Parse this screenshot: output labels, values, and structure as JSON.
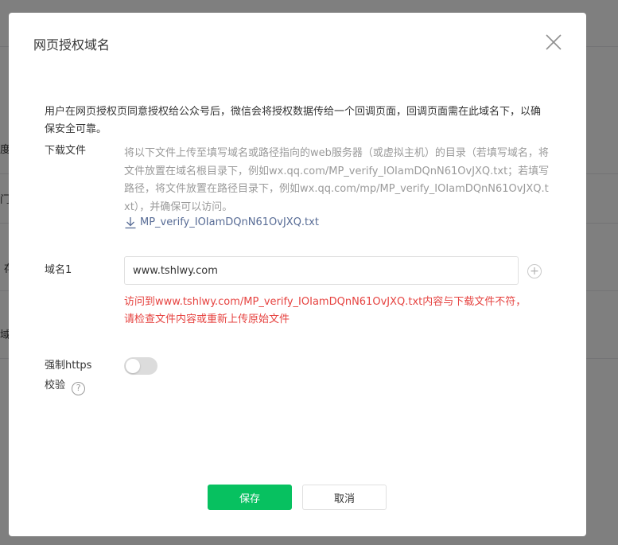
{
  "dialog": {
    "title": "网页授权域名",
    "intro": "用户在网页授权页同意授权给公众号后，微信会将授权数据传给一个回调页面，回调页面需在此域名下，以确保安全可靠。",
    "download": {
      "label": "下载文件",
      "description": "将以下文件上传至填写域名或路径指向的web服务器（或虚拟主机）的目录（若填写域名，将文件放置在域名根目录下，例如wx.qq.com/MP_verify_IOIamDQnN61OvJXQ.txt；若填写路径，将文件放置在路径目录下，例如wx.qq.com/mp/MP_verify_IOIamDQnN61OvJXQ.txt），并确保可以访问。",
      "file_name": "MP_verify_IOIamDQnN61OvJXQ.txt"
    },
    "domain": {
      "label": "域名1",
      "value": "www.tshlwy.com",
      "error": "访问到www.tshlwy.com/MP_verify_IOIamDQnN61OvJXQ.txt内容与下载文件不符，请检查文件内容或重新上传原始文件"
    },
    "https": {
      "label_line1": "强制https",
      "label_line2": "校验",
      "enabled": false
    },
    "buttons": {
      "save": "保存",
      "cancel": "取消"
    }
  },
  "background": {
    "fragments": [
      "度",
      "门",
      "存",
      "域"
    ]
  },
  "colors": {
    "primary": "#07c160",
    "error": "#e64340",
    "link": "#576b95",
    "muted": "#9a9a9a"
  },
  "icons": {
    "close": "close-icon",
    "download": "download-icon",
    "add": "plus-icon",
    "help": "question-icon"
  }
}
